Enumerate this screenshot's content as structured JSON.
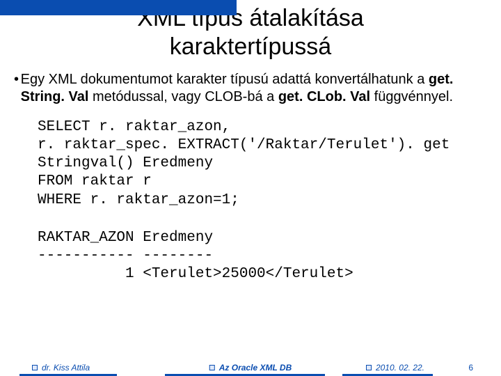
{
  "title_line1": "XML típus átalakítása",
  "title_line2": "karaktertípussá",
  "bullet": {
    "pre": "Egy XML dokumentumot karakter típusú adattá konvertálhatunk a ",
    "m1": "get. String. Val",
    "mid": " metódussal, vagy CLOB-bá a ",
    "m2": "get. CLob. Val",
    "post": " függvénnyel."
  },
  "code": "SELECT r. raktar_azon,\nr. raktar_spec. EXTRACT('/Raktar/Terulet'). get\nStringval() Eredmeny\nFROM raktar r\nWHERE r. raktar_azon=1;",
  "output": "RAKTAR_AZON Eredmeny\n----------- --------\n          1 <Terulet>25000</Terulet>",
  "footer": {
    "author": "dr. Kiss Attila",
    "center": "Az Oracle XML DB",
    "date": "2010. 02. 22.",
    "page": "6"
  }
}
